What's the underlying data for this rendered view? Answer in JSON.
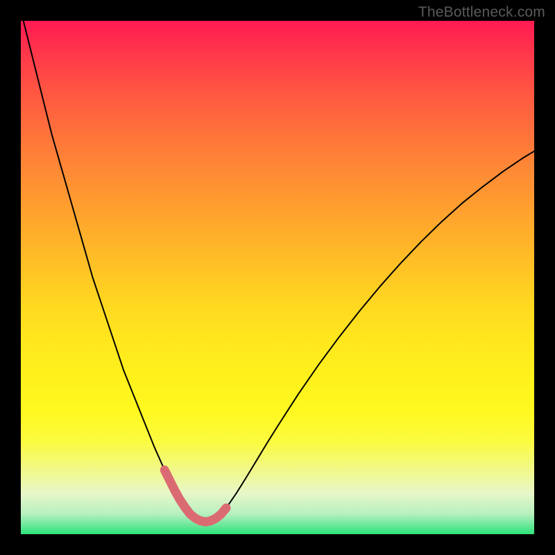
{
  "watermark": "TheBottleneck.com",
  "colors": {
    "background": "#000000",
    "gradient_top": "#ff1a52",
    "gradient_bottom": "#2de27a",
    "curve": "#000000",
    "highlight": "#db6b72"
  },
  "chart_data": {
    "type": "line",
    "title": "",
    "xlabel": "",
    "ylabel": "",
    "xlim": [
      0,
      100
    ],
    "ylim": [
      0,
      100
    ],
    "grid": false,
    "legend": false,
    "x": [
      0,
      2,
      4,
      6,
      8,
      10,
      12,
      14,
      16,
      18,
      20,
      22,
      24,
      26,
      28,
      29,
      30,
      31,
      32,
      33,
      34,
      35,
      36,
      37,
      38,
      39,
      40,
      42,
      44,
      46,
      48,
      50,
      54,
      58,
      62,
      66,
      70,
      74,
      78,
      82,
      86,
      90,
      94,
      98,
      100
    ],
    "series": [
      {
        "name": "bottleneck-curve",
        "y": [
          102,
          94,
          86,
          78,
          71,
          64,
          57,
          50,
          44,
          38,
          32,
          27,
          22,
          17,
          12.5,
          10.5,
          8.5,
          6.7,
          5.2,
          3.9,
          3.1,
          2.6,
          2.4,
          2.6,
          3.1,
          3.9,
          5.1,
          8.0,
          11.2,
          14.5,
          17.8,
          21.0,
          27.2,
          33.0,
          38.4,
          43.5,
          48.3,
          52.8,
          57.0,
          60.9,
          64.5,
          67.7,
          70.7,
          73.4,
          74.6
        ]
      },
      {
        "name": "highlight-segment",
        "x": [
          28,
          29,
          30,
          31,
          32,
          33,
          34,
          35,
          36,
          37,
          38,
          39,
          40
        ],
        "y": [
          12.5,
          10.5,
          8.5,
          6.7,
          5.2,
          3.9,
          3.1,
          2.6,
          2.4,
          2.6,
          3.1,
          3.9,
          5.1
        ]
      }
    ],
    "annotations": []
  }
}
